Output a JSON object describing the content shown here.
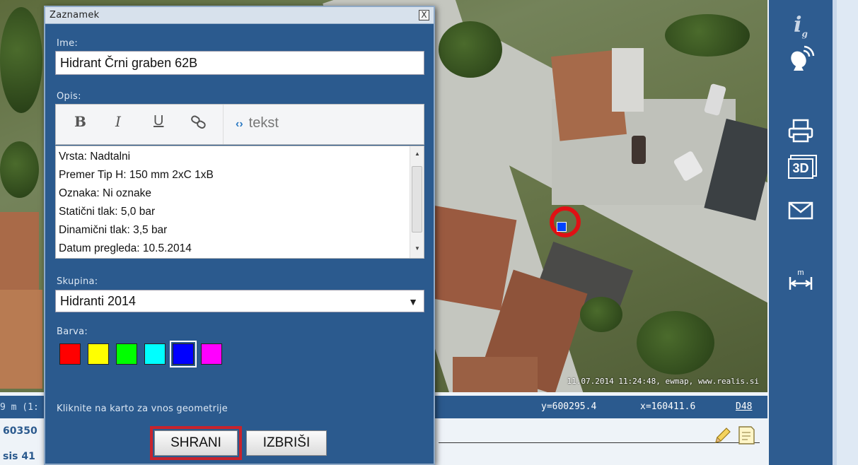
{
  "dialog": {
    "title": "Zaznamek",
    "close_label": "X",
    "name_label": "Ime:",
    "name_value": "Hidrant Črni graben 62B",
    "description_label": "Opis:",
    "editor": {
      "bold": "B",
      "italic": "I",
      "underline": "U",
      "link_icon": "link-icon",
      "source_label": "tekst"
    },
    "description_lines": [
      "Vrsta: Nadtalni",
      "Premer Tip H: 150 mm 2xC 1xB",
      "Oznaka: Ni oznake",
      "Statični tlak: 5,0 bar",
      "Dinamični tlak: 3,5 bar",
      "Datum pregleda: 10.5.2014"
    ],
    "group_label": "Skupina:",
    "group_value": "Hidranti 2014",
    "color_label": "Barva:",
    "colors": [
      {
        "name": "red",
        "hex": "#ff0000"
      },
      {
        "name": "yellow",
        "hex": "#ffff00"
      },
      {
        "name": "green",
        "hex": "#00ff00"
      },
      {
        "name": "cyan",
        "hex": "#00ffff"
      },
      {
        "name": "blue",
        "hex": "#0000ff",
        "selected": true
      },
      {
        "name": "magenta",
        "hex": "#ff00ff"
      }
    ],
    "hint": "Kliknite na karto za vnos geometrije",
    "save_label": "SHRANI",
    "delete_label": "IZBRIŠI"
  },
  "map": {
    "timestamp": "11.07.2014 11:24:48, ewmap, www.realis.si",
    "marker_color": "#e01014"
  },
  "status_bar": {
    "left_text": "9 m (1:",
    "y_coord": "y=600295.4",
    "x_coord": "x=160411.6",
    "datum_link": "D48"
  },
  "lower_panel": {
    "row1_text": "60350",
    "row2_text": "sis 41"
  },
  "toolbar": {
    "info_label": "i",
    "info_sub": "g",
    "three_d_label": "3D",
    "measure_label": "m",
    "icons": [
      "info-icon",
      "satellite-icon",
      "print-icon",
      "3d-icon",
      "mail-icon",
      "measure-icon"
    ]
  },
  "accent_color": "#2b5a8e"
}
